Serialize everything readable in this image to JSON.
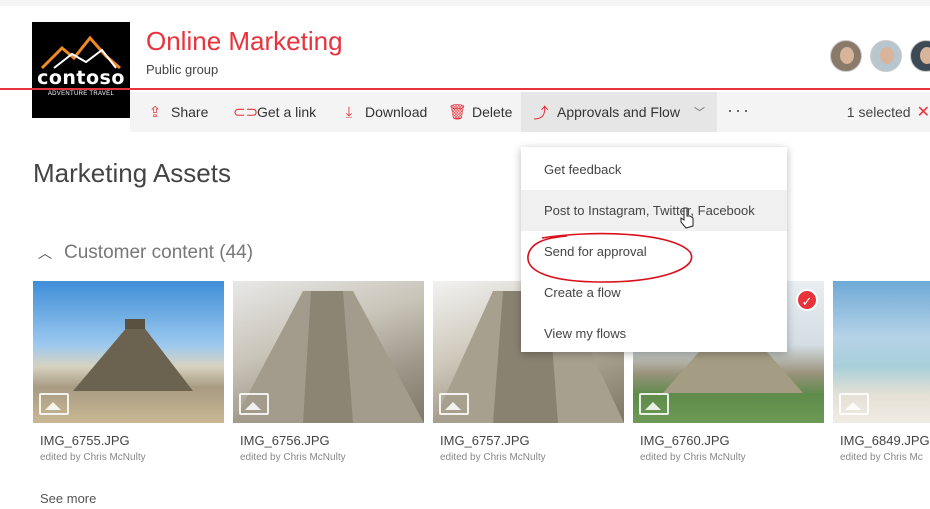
{
  "header": {
    "logo_word": "contoso",
    "logo_sub": "ADVENTURE TRAVEL",
    "site_title": "Online Marketing",
    "site_subtitle": "Public group"
  },
  "commandbar": {
    "share": "Share",
    "get_link": "Get a link",
    "download": "Download",
    "delete": "Delete",
    "approvals": "Approvals and Flow",
    "more": "···",
    "selected": "1 selected"
  },
  "page": {
    "title": "Marketing Assets",
    "section_title": "Customer content (44)",
    "see_more": "See more"
  },
  "files": [
    {
      "name": "IMG_6755.JPG",
      "meta": "edited by Chris McNulty"
    },
    {
      "name": "IMG_6756.JPG",
      "meta": "edited by Chris McNulty"
    },
    {
      "name": "IMG_6757.JPG",
      "meta": "edited by Chris McNulty"
    },
    {
      "name": "IMG_6760.JPG",
      "meta": "edited by Chris McNulty"
    },
    {
      "name": "IMG_6849.JPG",
      "meta": "edited by Chris Mc"
    }
  ],
  "dropdown": {
    "items": [
      "Get feedback",
      "Post to Instagram, Twitter, Facebook",
      "Send for approval",
      "Create a flow",
      "View my flows"
    ]
  },
  "icons": {
    "share": "share-icon",
    "link": "link-icon",
    "download": "download-icon",
    "delete": "trash-icon",
    "flow": "flow-icon",
    "close": "close-icon",
    "check": "checkmark-icon",
    "caret": "caret-up-icon"
  },
  "colors": {
    "accent": "#e8323c",
    "command_bar": "#f4f4f4",
    "selected_check": "#e8323c"
  }
}
